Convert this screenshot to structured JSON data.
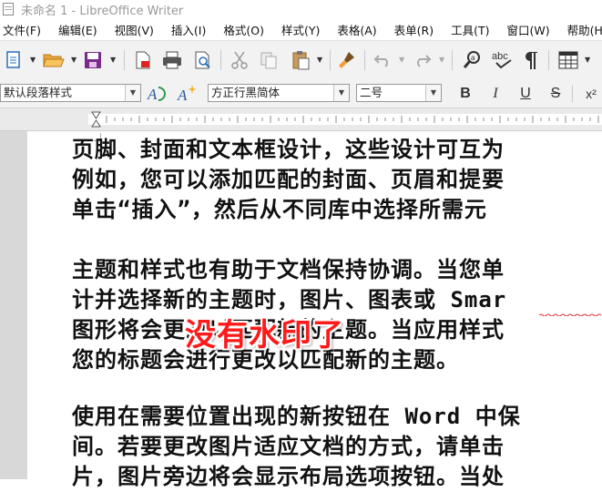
{
  "window": {
    "title": "未命名 1 - LibreOffice Writer"
  },
  "menu": [
    "文件(F)",
    "编辑(E)",
    "视图(V)",
    "插入(I)",
    "格式(O)",
    "样式(Y)",
    "表格(A)",
    "表单(R)",
    "工具(T)",
    "窗口(W)",
    "帮助(H)"
  ],
  "toolbar_icons": [
    "new-document-icon",
    "open-folder-icon",
    "save-icon",
    "export-pdf-icon",
    "print-icon",
    "print-preview-icon",
    "cut-icon",
    "copy-icon",
    "paste-icon",
    "clone-formatting-icon",
    "undo-icon",
    "redo-icon",
    "find-replace-icon",
    "spelling-icon",
    "formatting-marks-icon",
    "insert-table-icon"
  ],
  "formatting": {
    "paragraph_style": "默认段落样式",
    "font_name": "方正行黑简体",
    "font_size": "二号",
    "bold": "B",
    "italic": "I",
    "underline": "U",
    "strikethrough": "S",
    "superscript": "x²"
  },
  "document": {
    "lines": [
      "页脚、封面和文本框设计，这些设计可互为",
      "例如，您可以添加匹配的封面、页眉和提要",
      "单击“插入”，然后从不同库中选择所需元",
      "主题和样式也有助于文档保持协调。当您单",
      "计并选择新的主题时，图片、图表或 Smar",
      "图形将会更改以匹配新的主题。当应用样式",
      "您的标题会进行更改以匹配新的主题。",
      "使用在需要位置出现的新按钮在 Word 中保",
      "间。若要更改图片适应文档的方式，请单击",
      "片，图片旁边将会显示布局选项按钮。当处"
    ],
    "stamp_text": "没有水印了"
  },
  "colors": {
    "stamp": "#ff1a1a",
    "toolbar_bg": "#f2f2f2",
    "doc_bg": "#d8d8d8"
  }
}
